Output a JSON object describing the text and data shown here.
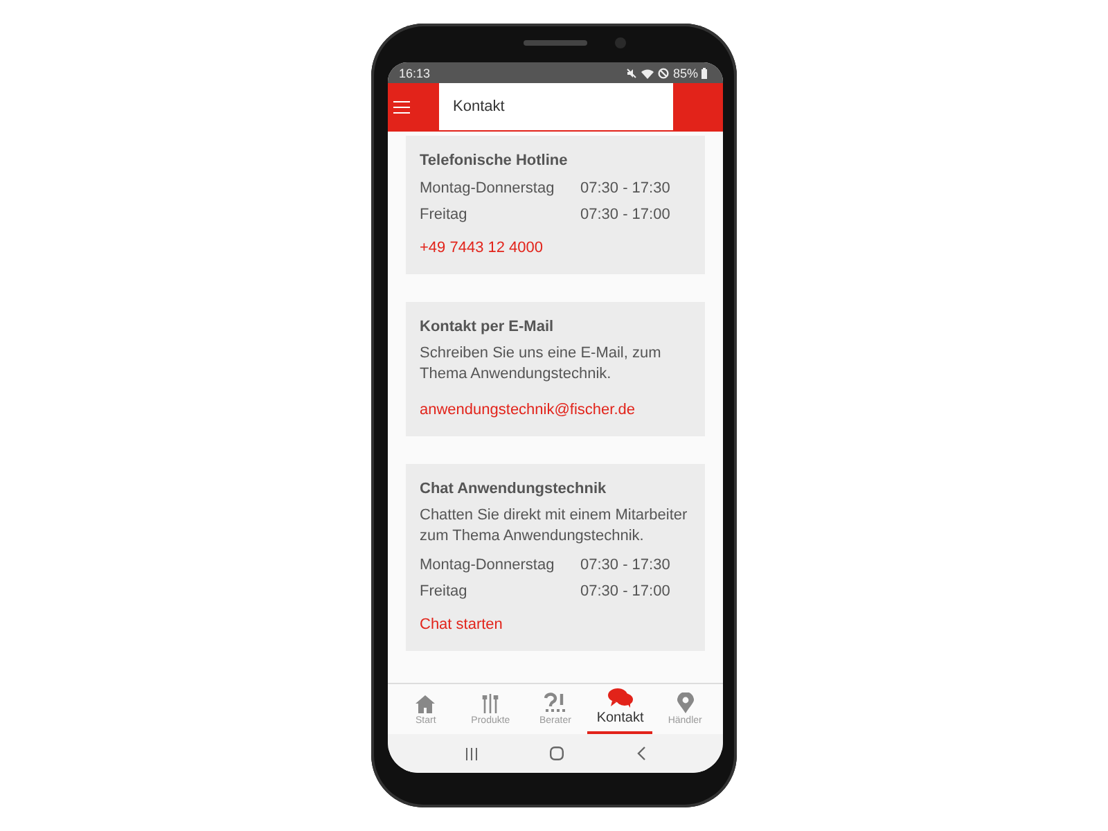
{
  "status_bar": {
    "time": "16:13",
    "battery": "85%"
  },
  "app_bar": {
    "title": "Kontakt"
  },
  "cards": [
    {
      "title": "Telefonische Hotline",
      "hours": [
        {
          "day": "Montag-Donnerstag",
          "time": "07:30 - 17:30"
        },
        {
          "day": "Freitag",
          "time": "07:30 - 17:00"
        }
      ],
      "link": "+49 7443 12 4000"
    },
    {
      "title": "Kontakt per E-Mail",
      "description": "Schreiben Sie uns eine E-Mail, zum Thema Anwendungstechnik.",
      "link": "anwendungstechnik@fischer.de"
    },
    {
      "title": "Chat Anwendungstechnik",
      "description": "Chatten Sie direkt mit einem Mitarbeiter zum Thema Anwendungstechnik.",
      "hours": [
        {
          "day": "Montag-Donnerstag",
          "time": "07:30 - 17:30"
        },
        {
          "day": "Freitag",
          "time": "07:30 - 17:00"
        }
      ],
      "link": "Chat starten"
    }
  ],
  "bottom_nav": [
    {
      "label": "Start",
      "selected": false
    },
    {
      "label": "Produkte",
      "selected": false
    },
    {
      "label": "Berater",
      "selected": false
    },
    {
      "label": "Kontakt",
      "selected": true
    },
    {
      "label": "Händler",
      "selected": false
    }
  ]
}
